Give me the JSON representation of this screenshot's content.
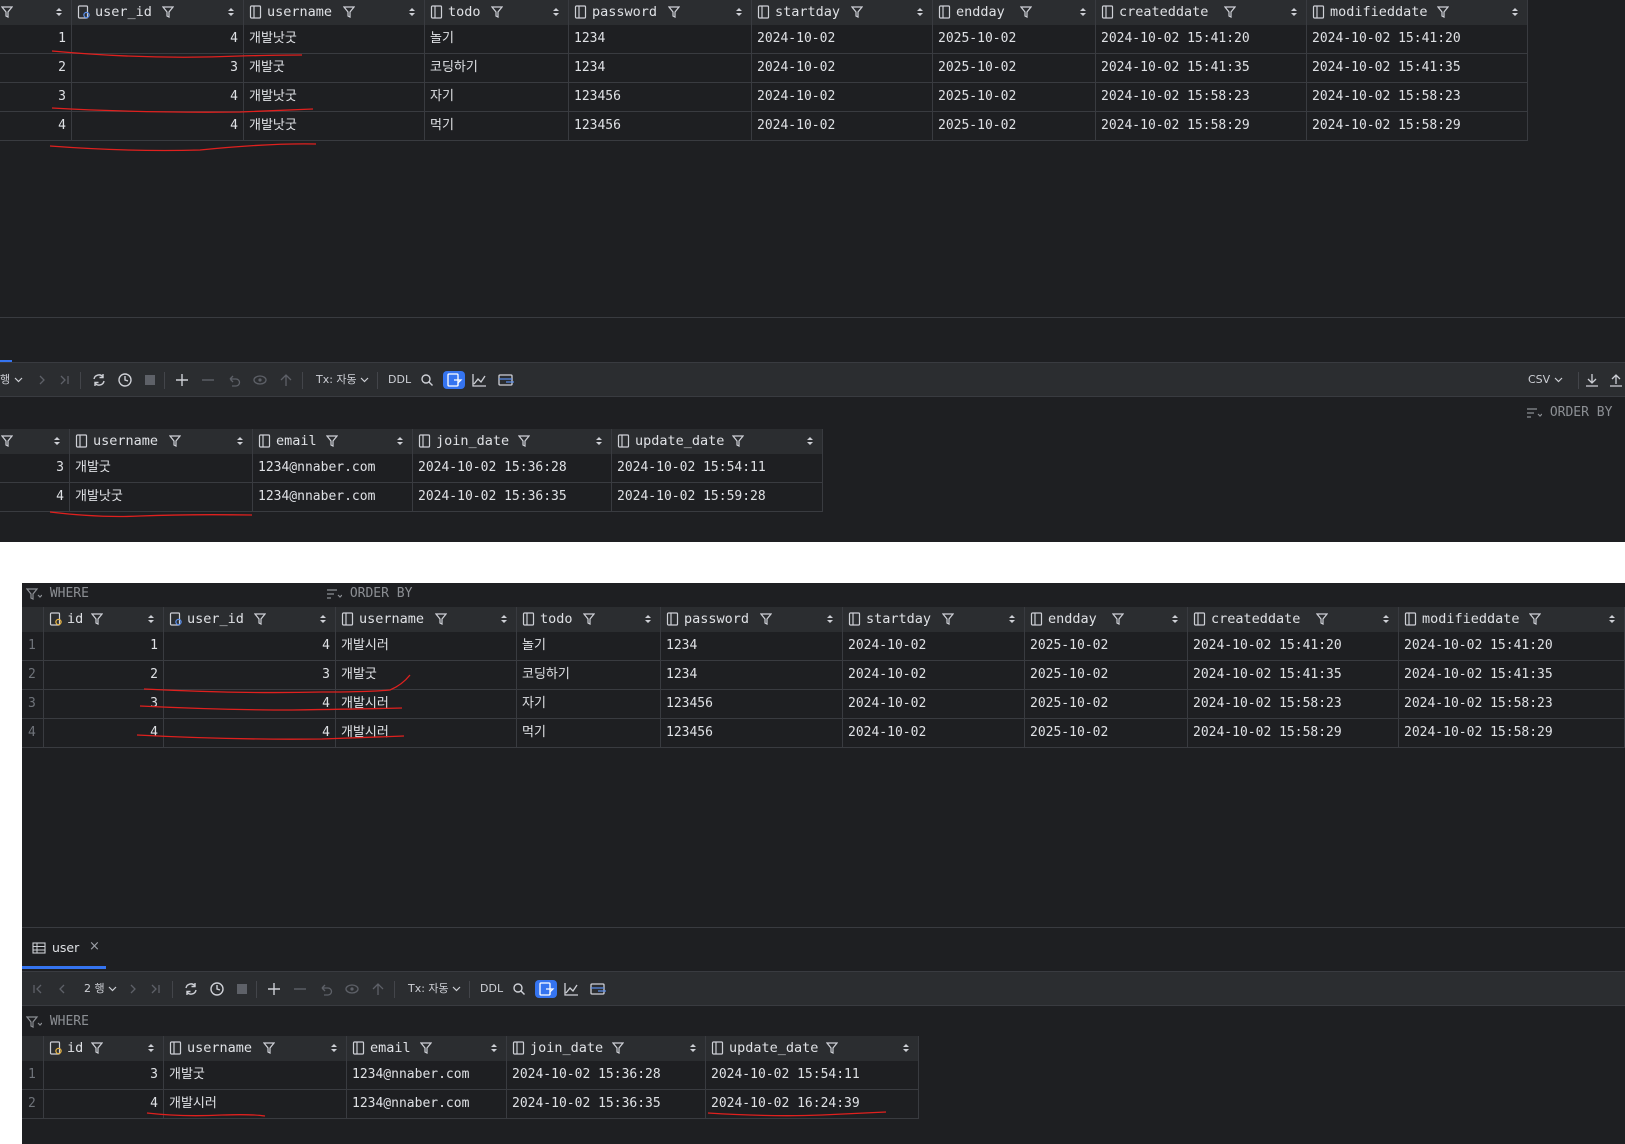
{
  "top": {
    "todo_table": {
      "columns": [
        "user_id",
        "username",
        "todo",
        "password",
        "startday",
        "endday",
        "createddate",
        "modifieddate"
      ],
      "rows": [
        {
          "id": "1",
          "user_id": "4",
          "username": "개발낫굿",
          "todo": "놀기",
          "password": "1234",
          "startday": "2024-10-02",
          "endday": "2025-10-02",
          "createddate": "2024-10-02 15:41:20",
          "modifieddate": "2024-10-02 15:41:20"
        },
        {
          "id": "2",
          "user_id": "3",
          "username": "개발굿",
          "todo": "코딩하기",
          "password": "1234",
          "startday": "2024-10-02",
          "endday": "2025-10-02",
          "createddate": "2024-10-02 15:41:35",
          "modifieddate": "2024-10-02 15:41:35"
        },
        {
          "id": "3",
          "user_id": "4",
          "username": "개발낫굿",
          "todo": "자기",
          "password": "123456",
          "startday": "2024-10-02",
          "endday": "2025-10-02",
          "createddate": "2024-10-02 15:58:23",
          "modifieddate": "2024-10-02 15:58:23"
        },
        {
          "id": "4",
          "user_id": "4",
          "username": "개발낫굿",
          "todo": "먹기",
          "password": "123456",
          "startday": "2024-10-02",
          "endday": "2025-10-02",
          "createddate": "2024-10-02 15:58:29",
          "modifieddate": "2024-10-02 15:58:29"
        }
      ]
    },
    "toolbar": {
      "page_suffix": "행",
      "tx_label": "Tx: 자동",
      "ddl_label": "DDL",
      "export_format": "CSV"
    },
    "order_by_label": "ORDER BY",
    "user_table": {
      "columns": [
        "username",
        "email",
        "join_date",
        "update_date"
      ],
      "rows": [
        {
          "id": "3",
          "username": "개발굿",
          "email": "1234@nnaber.com",
          "join_date": "2024-10-02 15:36:28",
          "update_date": "2024-10-02 15:54:11"
        },
        {
          "id": "4",
          "username": "개발낫굿",
          "email": "1234@nnaber.com",
          "join_date": "2024-10-02 15:36:35",
          "update_date": "2024-10-02 15:59:28"
        }
      ]
    }
  },
  "bottom": {
    "where_label": "WHERE",
    "order_by_label": "ORDER BY",
    "todo_table": {
      "columns": [
        "id",
        "user_id",
        "username",
        "todo",
        "password",
        "startday",
        "endday",
        "createddate",
        "modifieddate"
      ],
      "rows": [
        {
          "rownum": "1",
          "id": "1",
          "user_id": "4",
          "username": "개발시러",
          "todo": "놀기",
          "password": "1234",
          "startday": "2024-10-02",
          "endday": "2025-10-02",
          "createddate": "2024-10-02 15:41:20",
          "modifieddate": "2024-10-02 15:41:20"
        },
        {
          "rownum": "2",
          "id": "2",
          "user_id": "3",
          "username": "개발굿",
          "todo": "코딩하기",
          "password": "1234",
          "startday": "2024-10-02",
          "endday": "2025-10-02",
          "createddate": "2024-10-02 15:41:35",
          "modifieddate": "2024-10-02 15:41:35"
        },
        {
          "rownum": "3",
          "id": "3",
          "user_id": "4",
          "username": "개발시러",
          "todo": "자기",
          "password": "123456",
          "startday": "2024-10-02",
          "endday": "2025-10-02",
          "createddate": "2024-10-02 15:58:23",
          "modifieddate": "2024-10-02 15:58:23"
        },
        {
          "rownum": "4",
          "id": "4",
          "user_id": "4",
          "username": "개발시러",
          "todo": "먹기",
          "password": "123456",
          "startday": "2024-10-02",
          "endday": "2025-10-02",
          "createddate": "2024-10-02 15:58:29",
          "modifieddate": "2024-10-02 15:58:29"
        }
      ]
    },
    "tab": {
      "label": "user",
      "close": "×"
    },
    "toolbar": {
      "row_count": "2 행",
      "tx_label": "Tx: 자동",
      "ddl_label": "DDL"
    },
    "user_where_label": "WHERE",
    "user_table": {
      "columns": [
        "id",
        "username",
        "email",
        "join_date",
        "update_date"
      ],
      "rows": [
        {
          "rownum": "1",
          "id": "3",
          "username": "개발굿",
          "email": "1234@nnaber.com",
          "join_date": "2024-10-02 15:36:28",
          "update_date": "2024-10-02 15:54:11"
        },
        {
          "rownum": "2",
          "id": "4",
          "username": "개발시러",
          "email": "1234@nnaber.com",
          "join_date": "2024-10-02 15:36:35",
          "update_date": "2024-10-02 16:24:39"
        }
      ]
    }
  },
  "colors": {
    "panel_bg": "#1e1f22",
    "header_bg": "#2b2d30",
    "grid_line": "#393b40",
    "annotation_red": "#e0201e",
    "accent_blue": "#3574f0"
  }
}
